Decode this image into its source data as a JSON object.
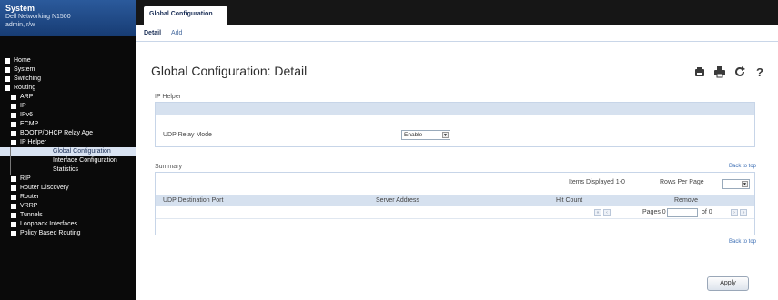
{
  "system": {
    "title": "System",
    "model": "Dell Networking N1500",
    "user": "admin, r/w"
  },
  "nav_tree": [
    {
      "label": "Home",
      "indent": 0,
      "expanded": false
    },
    {
      "label": "System",
      "indent": 0,
      "expanded": true
    },
    {
      "label": "Switching",
      "indent": 0,
      "expanded": true
    },
    {
      "label": "Routing",
      "indent": 0,
      "expanded": true
    },
    {
      "label": "ARP",
      "indent": 1,
      "expanded": true
    },
    {
      "label": "IP",
      "indent": 1,
      "expanded": true
    },
    {
      "label": "IPv6",
      "indent": 1,
      "expanded": true
    },
    {
      "label": "ECMP",
      "indent": 1,
      "expanded": true
    },
    {
      "label": "BOOTP/DHCP Relay Age",
      "indent": 1,
      "expanded": true
    },
    {
      "label": "IP Helper",
      "indent": 1,
      "expanded": false
    },
    {
      "label": "Global Configuration",
      "indent": 2,
      "selected": true
    },
    {
      "label": "Interface Configuration",
      "indent": 2
    },
    {
      "label": "Statistics",
      "indent": 2
    },
    {
      "label": "RIP",
      "indent": 1,
      "expanded": true
    },
    {
      "label": "Router Discovery",
      "indent": 1,
      "expanded": true
    },
    {
      "label": "Router",
      "indent": 1,
      "expanded": true
    },
    {
      "label": "VRRP",
      "indent": 1,
      "expanded": true
    },
    {
      "label": "Tunnels",
      "indent": 1,
      "expanded": true
    },
    {
      "label": "Loopback Interfaces",
      "indent": 1,
      "expanded": true
    },
    {
      "label": "Policy Based Routing",
      "indent": 1,
      "expanded": true
    }
  ],
  "top_tab": "Global Configuration",
  "sub_tabs": {
    "detail": "Detail",
    "add": "Add"
  },
  "page": {
    "title": "Global Configuration: Detail",
    "icons": [
      "save-icon",
      "print-icon",
      "refresh-icon",
      "help-icon"
    ]
  },
  "ip_helper": {
    "section_label": "IP Helper",
    "udp_relay_label": "UDP Relay Mode",
    "udp_relay_value": "Enable"
  },
  "summary": {
    "section_label": "Summary",
    "back_to_top": "Back to top",
    "items_displayed": "Items Displayed 1-0",
    "rows_per_page_label": "Rows Per Page",
    "rows_per_page_value": "",
    "columns": [
      "UDP Destination Port",
      "Server Address",
      "Hit Count",
      "Remove"
    ],
    "pages_label": "Pages 0",
    "of_label": "of 0"
  },
  "back_to_top_bottom": "Back to top",
  "apply_label": "Apply"
}
